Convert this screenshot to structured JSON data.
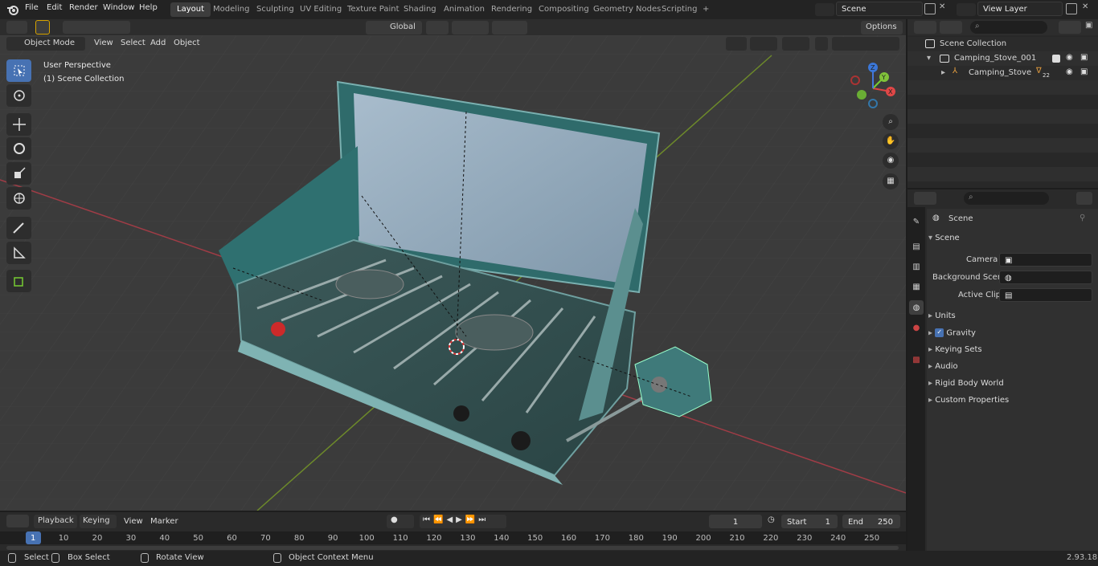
{
  "menu": [
    "File",
    "Edit",
    "Render",
    "Window",
    "Help"
  ],
  "workspaces": [
    "Layout",
    "Modeling",
    "Sculpting",
    "UV Editing",
    "Texture Paint",
    "Shading",
    "Animation",
    "Rendering",
    "Compositing",
    "Geometry Nodes",
    "Scripting"
  ],
  "scene_name": "Scene",
  "view_layer": "View Layer",
  "viewport_header": {
    "mode": "Object Mode",
    "view": "View",
    "select": "Select",
    "add": "Add",
    "object": "Object",
    "orientation": "Global",
    "options": "Options"
  },
  "overlay_text": {
    "perspective": "User Perspective",
    "collection": "(1) Scene Collection"
  },
  "gizmo": {
    "x": "X",
    "y": "Y",
    "z": "Z"
  },
  "outliner": {
    "root": "Scene Collection",
    "collection": "Camping_Stove_001",
    "object": "Camping_Stove",
    "vertex_count": "22"
  },
  "properties": {
    "title": "Scene",
    "section": "Scene",
    "camera_label": "Camera",
    "background_label": "Background Scene",
    "clip_label": "Active Clip",
    "panels": [
      "Units",
      "Gravity",
      "Keying Sets",
      "Audio",
      "Rigid Body World",
      "Custom Properties"
    ]
  },
  "timeline": {
    "playback": "Playback",
    "keying": "Keying",
    "view": "View",
    "marker": "Marker",
    "current_frame": "1",
    "start_label": "Start",
    "start": "1",
    "end_label": "End",
    "end": "250",
    "ticks": [
      "1",
      "10",
      "20",
      "30",
      "40",
      "50",
      "60",
      "70",
      "80",
      "90",
      "100",
      "110",
      "120",
      "130",
      "140",
      "150",
      "160",
      "170",
      "180",
      "190",
      "200",
      "210",
      "220",
      "230",
      "240",
      "250"
    ]
  },
  "status": {
    "select": "Select",
    "box_select": "Box Select",
    "rotate": "Rotate View",
    "context": "Object Context Menu",
    "version": "2.93.18"
  },
  "colors": {
    "accent": "#4772b3",
    "stove": "#2f6b6b",
    "knob": "#cc2a2a"
  }
}
